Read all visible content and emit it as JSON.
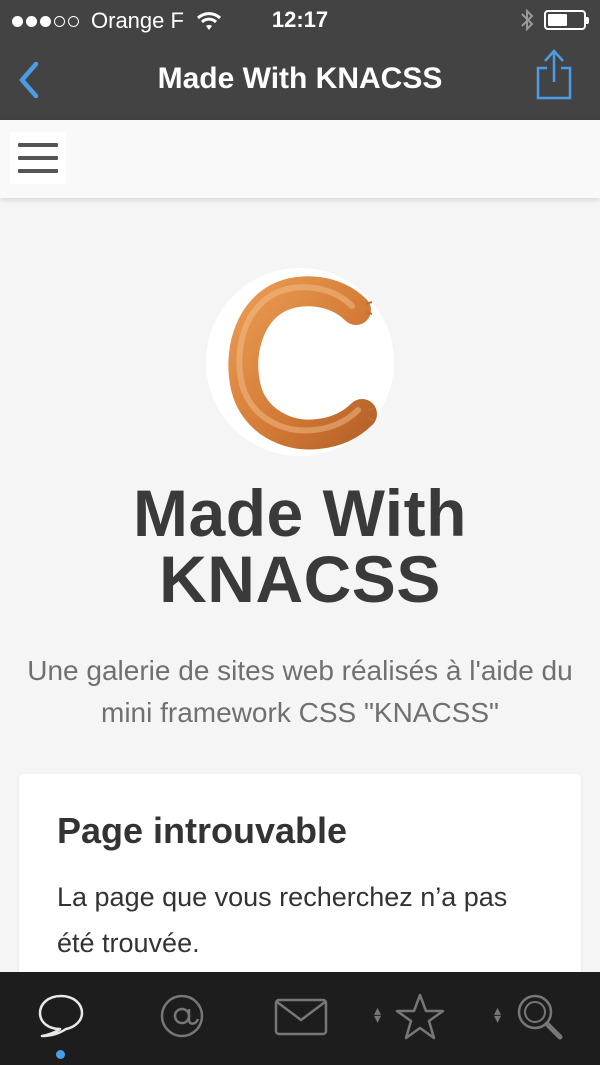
{
  "status_bar": {
    "carrier": "Orange F",
    "time": "12:17",
    "signal_bars_filled": 3,
    "signal_bars_total": 5,
    "battery_level": 0.55
  },
  "nav": {
    "title": "Made With KNACSS",
    "back_icon": "chevron-left-icon",
    "share_icon": "share-icon"
  },
  "site": {
    "menu_icon": "hamburger-icon",
    "title_line1": "Made With",
    "title_line2": "KNACSS",
    "tagline": "Une galerie de sites web réalisés à l'aide du mini framework CSS \"KNACSS\""
  },
  "card": {
    "heading": "Page introuvable",
    "text": "La page que vous recherchez n’a pas été trouvée."
  },
  "tabs": [
    {
      "icon": "speech-bubble-icon",
      "active": true
    },
    {
      "icon": "at-sign-icon",
      "active": false
    },
    {
      "icon": "envelope-icon",
      "active": false
    },
    {
      "icon": "star-icon",
      "active": false
    },
    {
      "icon": "search-icon",
      "active": false
    }
  ],
  "colors": {
    "bar_bg": "#434343",
    "accent": "#4a9ee8",
    "tab_bar_bg": "#1d1d1d",
    "logo_orange": "#d9813a"
  }
}
